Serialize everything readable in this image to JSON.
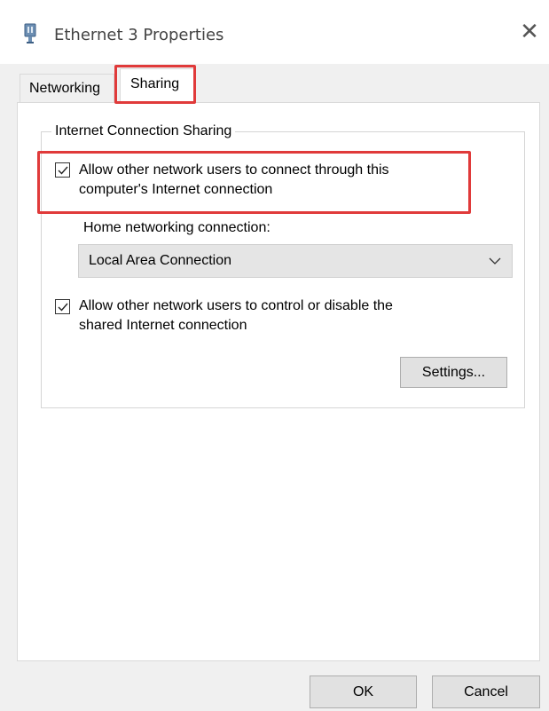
{
  "window": {
    "title": "Ethernet 3 Properties",
    "close_glyph": "✕",
    "icon": "network-adapter-icon"
  },
  "tabs": [
    {
      "label": "Networking",
      "selected": false
    },
    {
      "label": "Sharing",
      "selected": true
    }
  ],
  "sharing": {
    "group_title": "Internet Connection Sharing",
    "allow_connect": {
      "checked": true,
      "label_line1": "Allow other network users to connect through this",
      "label_line2": "computer's Internet connection"
    },
    "home_connection": {
      "label": "Home networking connection:",
      "selected_value": "Local Area Connection",
      "chevron_icon": "chevron-down-icon"
    },
    "allow_control": {
      "checked": true,
      "label_line1": "Allow other network users to control or disable the",
      "label_line2": "shared Internet connection"
    },
    "settings_button": "Settings..."
  },
  "footer": {
    "ok_label": "OK",
    "cancel_label": "Cancel"
  },
  "colors": {
    "highlight": "#e03a3a",
    "dialog_background": "#f0f0f0",
    "panel_background": "#ffffff"
  }
}
